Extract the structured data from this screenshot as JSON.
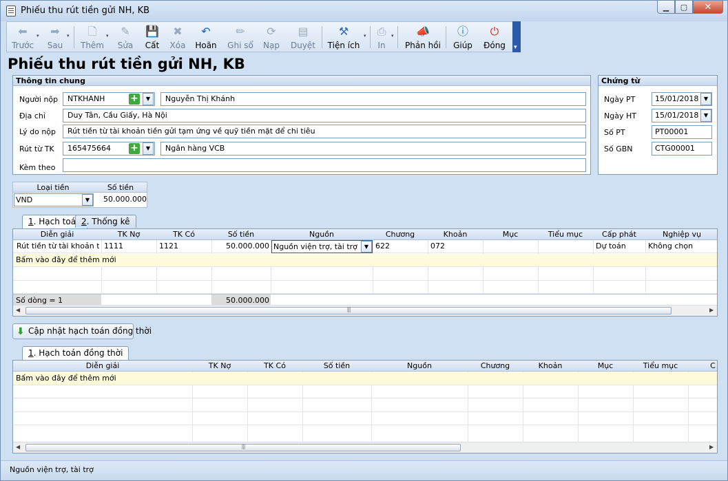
{
  "window": {
    "title": "Phiếu thu rút tiền gửi NH, KB"
  },
  "toolbar": {
    "items": [
      {
        "label": "Trước",
        "icon": "arrow-left-icon"
      },
      {
        "label": "Sau",
        "icon": "arrow-right-icon"
      },
      {
        "label": "Thêm",
        "icon": "add-doc-icon"
      },
      {
        "label": "Sửa",
        "icon": "edit-doc-icon"
      },
      {
        "label": "Cất",
        "icon": "save-icon"
      },
      {
        "label": "Xóa",
        "icon": "delete-icon"
      },
      {
        "label": "Hoãn",
        "icon": "undo-icon"
      },
      {
        "label": "Ghi sổ",
        "icon": "pencil-icon"
      },
      {
        "label": "Nạp",
        "icon": "reload-icon"
      },
      {
        "label": "Duyệt",
        "icon": "approve-icon"
      },
      {
        "label": "Tiện ích",
        "icon": "tools-icon"
      },
      {
        "label": "In",
        "icon": "print-icon"
      },
      {
        "label": "Phản hồi",
        "icon": "megaphone-icon"
      },
      {
        "label": "Giúp",
        "icon": "help-icon"
      },
      {
        "label": "Đóng",
        "icon": "power-icon"
      }
    ]
  },
  "page": {
    "title": "Phiếu thu rút tiền gửi NH, KB"
  },
  "general": {
    "header": "Thông tin chung",
    "payer_label": "Người nộp",
    "payer_code": "NTKHANH",
    "payer_name": "Nguyễn Thị Khánh",
    "address_label": "Địa chỉ",
    "address": "Duy Tân, Cầu Giấy, Hà Nội",
    "reason_label": "Lý do nộp",
    "reason": "Rút tiền từ tài khoản tiền gửi tạm ứng về quỹ tiền mặt để chi tiêu",
    "account_label": "Rút từ TK",
    "account_no": "165475664",
    "bank_name": "Ngân hàng VCB",
    "attach_label": "Kèm theo",
    "attach": ""
  },
  "voucher": {
    "header": "Chứng từ",
    "date_pt_label": "Ngày PT",
    "date_pt": "15/01/2018",
    "date_ht_label": "Ngày HT",
    "date_ht": "15/01/2018",
    "so_pt_label": "Số PT",
    "so_pt": "PT00001",
    "so_gbn_label": "Số GBN",
    "so_gbn": "CTG00001"
  },
  "currency": {
    "type_label": "Loại tiền",
    "amount_label": "Số tiền",
    "type": "VND",
    "amount": "50.000.000"
  },
  "tabs1": [
    {
      "num": "1",
      "label": ". Hạch toán"
    },
    {
      "num": "2",
      "label": ". Thống kê"
    }
  ],
  "grid1": {
    "headers": [
      "Diễn giải",
      "TK Nợ",
      "TK Có",
      "Số tiền",
      "Nguồn",
      "Chương",
      "Khoản",
      "Mục",
      "Tiểu mục",
      "Cấp phát",
      "Nghiệp vụ"
    ],
    "row": {
      "desc": "Rút tiền từ tài khoản ti...",
      "tk_no": "1111",
      "tk_co": "1121",
      "amount": "50.000.000",
      "source": "Nguồn viện trợ, tài trợ",
      "chuong": "622",
      "khoan": "072",
      "muc": "",
      "tieu_muc": "",
      "cap_phat": "Dự toán",
      "nghiep_vu": "Không chọn"
    },
    "add_row": "Bấm vào đây để thêm mới",
    "footer_count": "Số dòng = 1",
    "footer_amount": "50.000.000"
  },
  "update_button": "Cập nhật hạch toán đồng thời",
  "tabs2": [
    {
      "num": "1",
      "label": ". Hạch toán đồng thời"
    }
  ],
  "grid2": {
    "headers": [
      "Diễn giải",
      "TK Nợ",
      "TK Có",
      "Số tiền",
      "Nguồn",
      "Chương",
      "Khoản",
      "Mục",
      "Tiểu mục",
      "C"
    ],
    "add_row": "Bấm vào đây để thêm mới"
  },
  "status": {
    "text": "Nguồn viện trợ, tài trợ"
  }
}
